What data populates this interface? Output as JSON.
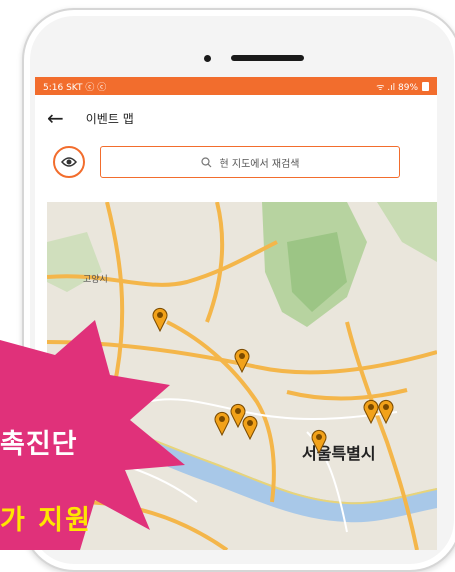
{
  "status_bar": {
    "left": "5:16 SKT ⓒ ⓒ",
    "right": "ᯤ .ıl 89%"
  },
  "header": {
    "title": "이벤트 맵"
  },
  "search": {
    "placeholder": "현 지도에서 재검색"
  },
  "map": {
    "city_label": "서울특별시",
    "district_label": "고양시",
    "pin_count": 8
  },
  "promo": {
    "line1": "촉진단",
    "line2": "가 지원"
  },
  "colors": {
    "accent": "#f26d2d",
    "promo": "#e0317a",
    "pin": "#f2a21a",
    "highlight": "#ffe600"
  }
}
